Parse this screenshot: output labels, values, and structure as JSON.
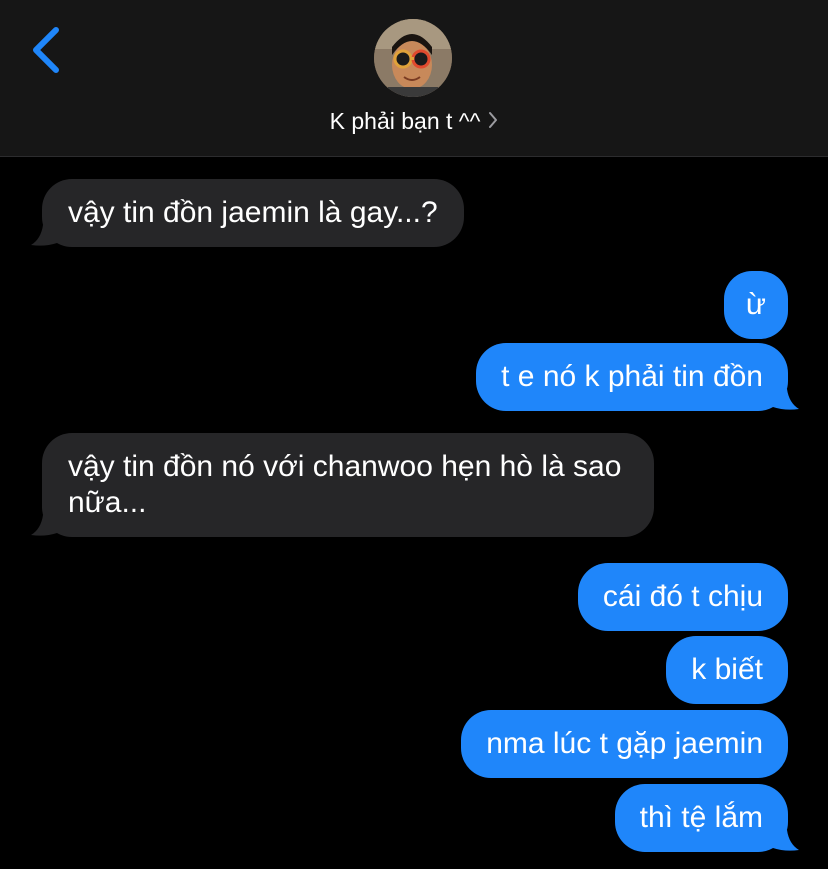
{
  "header": {
    "contact_name": "K phải bạn t ^^",
    "back_icon": "chevron-left-icon",
    "chevron_icon": "chevron-right-icon",
    "accent_color": "#1f86fa",
    "background_color": "#161616"
  },
  "messages": [
    {
      "direction": "incoming",
      "text": "vậy tin đồn jaemin là gay...?"
    },
    {
      "direction": "outgoing",
      "text": "ừ"
    },
    {
      "direction": "outgoing",
      "text": "t e nó k phải tin đồn"
    },
    {
      "direction": "incoming",
      "text": "vậy tin đồn nó với chanwoo hẹn hò là sao nữa..."
    },
    {
      "direction": "outgoing",
      "text": "cái đó t chịu"
    },
    {
      "direction": "outgoing",
      "text": "k biết"
    },
    {
      "direction": "outgoing",
      "text": "nma lúc t gặp jaemin"
    },
    {
      "direction": "outgoing",
      "text": "thì tệ lắm"
    }
  ],
  "colors": {
    "incoming_bubble": "#262628",
    "outgoing_bubble": "#1f86fa",
    "background": "#000000"
  }
}
